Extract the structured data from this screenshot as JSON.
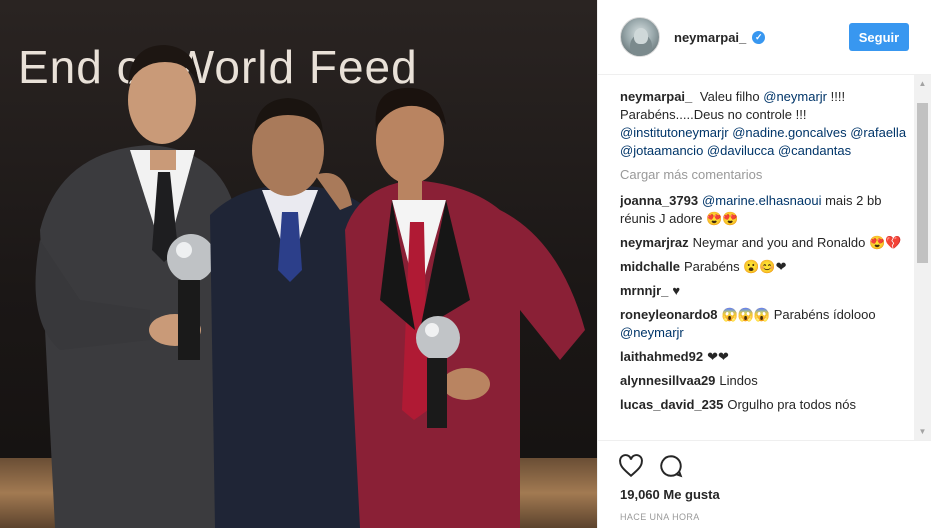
{
  "photo": {
    "backdrop_text": "End of World Feed"
  },
  "header": {
    "username": "neymarpai_",
    "verified_glyph": "✓",
    "follow_label": "Seguir"
  },
  "caption": {
    "user": "neymarpai_",
    "segments": [
      {
        "text": "Valeu filho "
      },
      {
        "text": "@neymarjr",
        "mention": true
      },
      {
        "text": " !!!! Parabéns.....Deus no controle !!! "
      },
      {
        "text": "@institutoneymarjr",
        "mention": true
      },
      {
        "text": " "
      },
      {
        "text": "@nadine.goncalves",
        "mention": true
      },
      {
        "text": " "
      },
      {
        "text": "@rafaella",
        "mention": true
      },
      {
        "text": " "
      },
      {
        "text": "@jotaamancio",
        "mention": true
      },
      {
        "text": " "
      },
      {
        "text": "@davilucca",
        "mention": true
      },
      {
        "text": " "
      },
      {
        "text": "@candantas",
        "mention": true
      }
    ]
  },
  "load_more": "Cargar más comentarios",
  "comments": [
    {
      "user": "joanna_3793",
      "segments": [
        {
          "text": "@marine.elhasnaoui",
          "mention": true
        },
        {
          "text": " mais 2 bb réunis J adore 😍😍"
        }
      ]
    },
    {
      "user": "neymarjraz",
      "segments": [
        {
          "text": "Neymar and you and Ronaldo 😍💔"
        }
      ]
    },
    {
      "user": "midchalle",
      "segments": [
        {
          "text": "Parabéns 😮😊❤"
        }
      ]
    },
    {
      "user": "mrnnjr_",
      "segments": [
        {
          "text": "♥"
        }
      ]
    },
    {
      "user": "roneyleonardo8",
      "segments": [
        {
          "text": "😱😱😱 Parabéns ídolooo "
        },
        {
          "text": "@neymarjr",
          "mention": true
        }
      ]
    },
    {
      "user": "laithahmed92",
      "segments": [
        {
          "text": "❤❤"
        }
      ]
    },
    {
      "user": "alynnesillvaa29",
      "segments": [
        {
          "text": "Lindos"
        }
      ]
    },
    {
      "user": "lucas_david_235",
      "segments": [
        {
          "text": "Orgulho pra todos nós"
        }
      ]
    }
  ],
  "actions": {
    "like_icon": "heart-icon",
    "comment_icon": "comment-icon",
    "likes_text": "19,060 Me gusta",
    "time_text": "HACE UNA HORA"
  },
  "colors": {
    "accent": "#3897f0",
    "mention": "#003569",
    "muted": "#999999"
  }
}
